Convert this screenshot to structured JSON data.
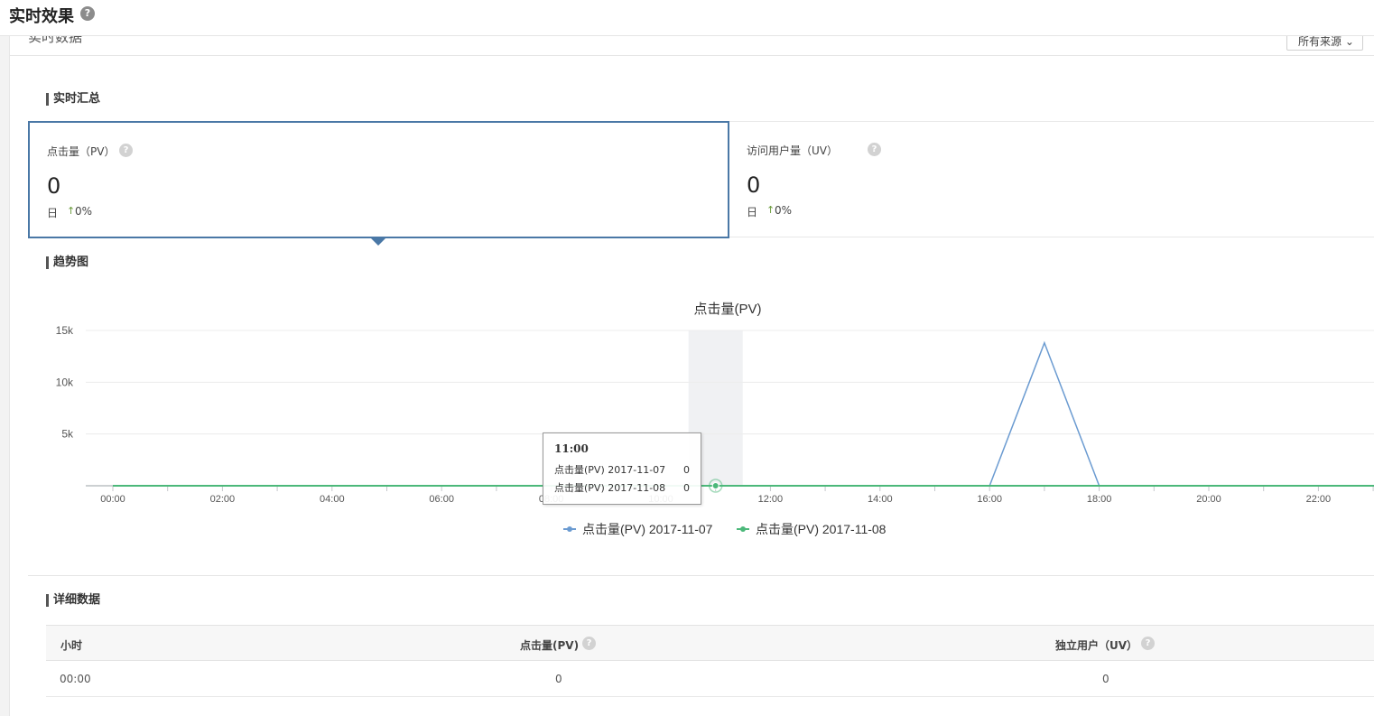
{
  "header": {
    "title": "实时效果",
    "help_icon": "question-circle-icon",
    "help_glyph": "?"
  },
  "subheader": {
    "title": "实时数据",
    "source_select": "所有来源",
    "source_caret": "⌄"
  },
  "summary": {
    "heading": "实时汇总",
    "cards": [
      {
        "label": "点击量（PV）",
        "value": "0",
        "period": "日",
        "arrow": "↑",
        "change": "0%",
        "help_glyph": "?"
      },
      {
        "label": "访问用户量（UV）",
        "value": "0",
        "period": "日",
        "arrow": "↑",
        "change": "0%",
        "help_glyph": "?"
      }
    ]
  },
  "trend": {
    "heading": "趋势图"
  },
  "chart_data": {
    "type": "line",
    "title": "点击量(PV)",
    "x": [
      "00:00",
      "01:00",
      "02:00",
      "03:00",
      "04:00",
      "05:00",
      "06:00",
      "07:00",
      "08:00",
      "09:00",
      "10:00",
      "11:00",
      "12:00",
      "13:00",
      "14:00",
      "15:00",
      "16:00",
      "17:00",
      "18:00",
      "19:00",
      "20:00",
      "21:00",
      "22:00",
      "23:00"
    ],
    "x_tick_labels": [
      "00:00",
      "02:00",
      "04:00",
      "06:00",
      "08:00",
      "10:00",
      "12:00",
      "14:00",
      "16:00",
      "18:00",
      "20:00",
      "22:00"
    ],
    "y_tick_labels": [
      "5k",
      "10k",
      "15k"
    ],
    "ylim": [
      0,
      15000
    ],
    "series": [
      {
        "name": "点击量(PV) 2017-11-07",
        "color": "#6b9bd1",
        "values": [
          0,
          0,
          0,
          0,
          0,
          0,
          0,
          0,
          0,
          0,
          0,
          0,
          0,
          0,
          0,
          0,
          0,
          13800,
          0,
          0,
          0,
          0,
          0,
          0
        ]
      },
      {
        "name": "点击量(PV) 2017-11-08",
        "color": "#4cb87a",
        "values": [
          0,
          0,
          0,
          0,
          0,
          0,
          0,
          0,
          0,
          0,
          0,
          0,
          0,
          0,
          0,
          0,
          0,
          0,
          0,
          0,
          0,
          0,
          0,
          0
        ]
      }
    ],
    "highlight_x": "11:00",
    "grid": true,
    "legend": "bottom-center",
    "tooltip": {
      "time": "11:00",
      "rows": [
        {
          "label": "点击量(PV) 2017-11-07",
          "value": "0"
        },
        {
          "label": "点击量(PV) 2017-11-08",
          "value": "0"
        }
      ]
    }
  },
  "details": {
    "heading": "详细数据",
    "columns": [
      "小时",
      "点击量(PV)",
      "独立用户（UV）"
    ],
    "help_glyph": "?",
    "rows": [
      [
        "00:00",
        "0",
        "0"
      ]
    ]
  }
}
